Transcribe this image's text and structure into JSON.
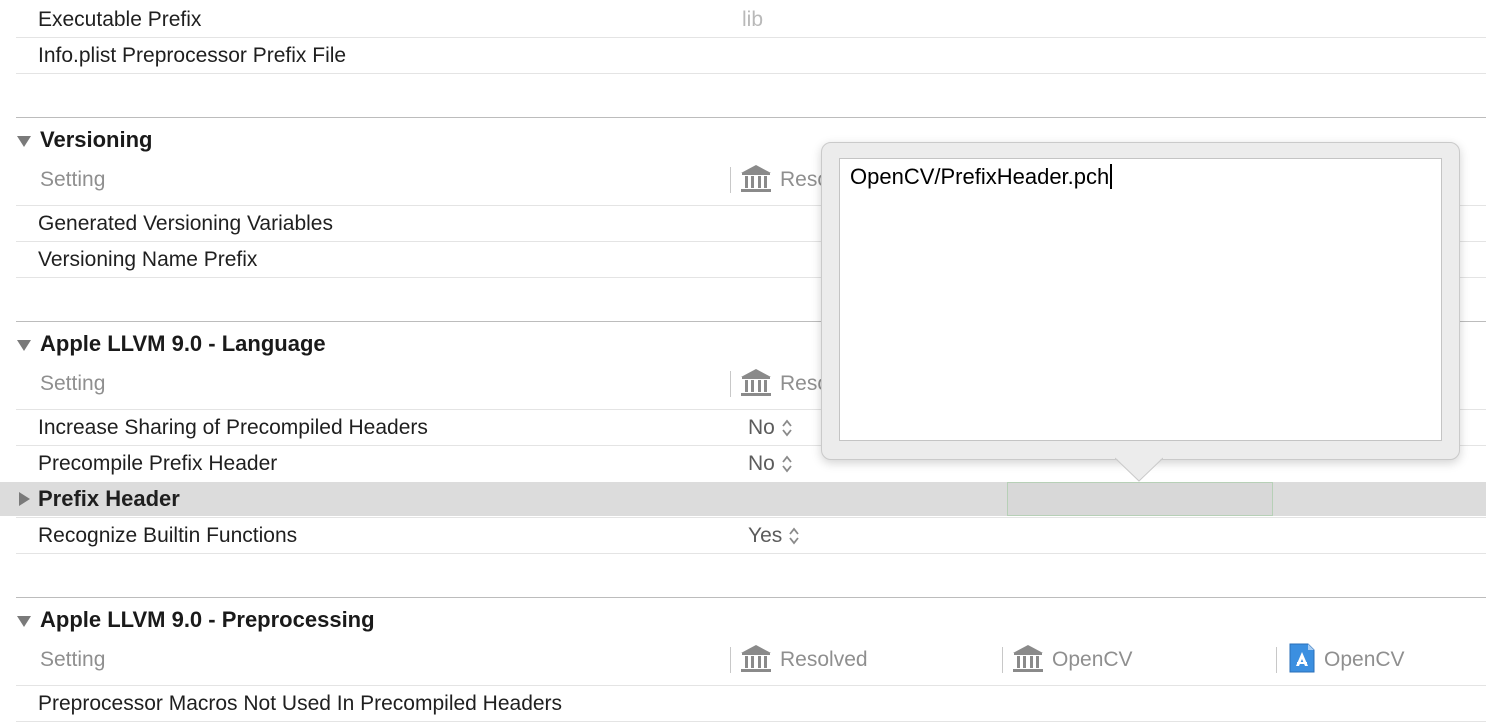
{
  "rows_top": [
    {
      "label": "Executable Prefix",
      "value": "lib"
    },
    {
      "label": "Info.plist Preprocessor Prefix File",
      "value": ""
    }
  ],
  "versioning": {
    "title": "Versioning",
    "setting_header": "Setting",
    "resolved_header": "Reso",
    "rows": [
      {
        "label": "Generated Versioning Variables"
      },
      {
        "label": "Versioning Name Prefix"
      }
    ]
  },
  "language": {
    "title": "Apple LLVM 9.0 - Language",
    "setting_header": "Setting",
    "resolved_header": "Reso",
    "rows": [
      {
        "label": "Increase Sharing of Precompiled Headers",
        "value": "No"
      },
      {
        "label": "Precompile Prefix Header",
        "value": "No"
      },
      {
        "label": "Prefix Header",
        "value": ""
      },
      {
        "label": "Recognize Builtin Functions",
        "value": "Yes"
      }
    ]
  },
  "preprocessing": {
    "title": "Apple LLVM 9.0 - Preprocessing",
    "setting_header": "Setting",
    "resolved_header": "Resolved",
    "project_header": "OpenCV",
    "target_header": "OpenCV",
    "rows": [
      {
        "label": "Preprocessor Macros Not Used In Precompiled Headers"
      }
    ]
  },
  "popover": {
    "text": "OpenCV/PrefixHeader.pch"
  },
  "colors": {
    "selected_row": "#dcdcdc",
    "popover_bg": "#ececec",
    "section_line": "#bcbcbc"
  }
}
